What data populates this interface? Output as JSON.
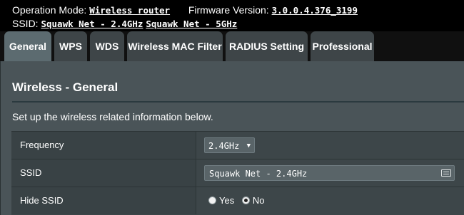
{
  "header": {
    "operation_mode_label": "Operation Mode:",
    "operation_mode_value": "Wireless router",
    "firmware_label": "Firmware Version:",
    "firmware_value": "3.0.0.4.376_3199",
    "ssid_label": "SSID:",
    "ssid_24": "Squawk Net - 2.4GHz",
    "ssid_5": "Squawk Net - 5GHz"
  },
  "tabs": [
    {
      "label": "General",
      "active": true
    },
    {
      "label": "WPS",
      "active": false
    },
    {
      "label": "WDS",
      "active": false
    },
    {
      "label": "Wireless MAC Filter",
      "active": false
    },
    {
      "label": "RADIUS Setting",
      "active": false
    },
    {
      "label": "Professional",
      "active": false
    }
  ],
  "section": {
    "title": "Wireless - General",
    "description": "Set up the wireless related information below."
  },
  "form": {
    "frequency": {
      "label": "Frequency",
      "value": "2.4GHz"
    },
    "ssid": {
      "label": "SSID",
      "value": "Squawk Net - 2.4GHz",
      "icon": "keyboard-icon"
    },
    "hide_ssid": {
      "label": "Hide SSID",
      "options": [
        "Yes",
        "No"
      ],
      "selected": "No"
    }
  },
  "colors": {
    "topbar_bg": "#000000",
    "tab_active": "#5c6b70",
    "tab_inactive": "#3e4548",
    "panel_bg": "#4a5458"
  }
}
